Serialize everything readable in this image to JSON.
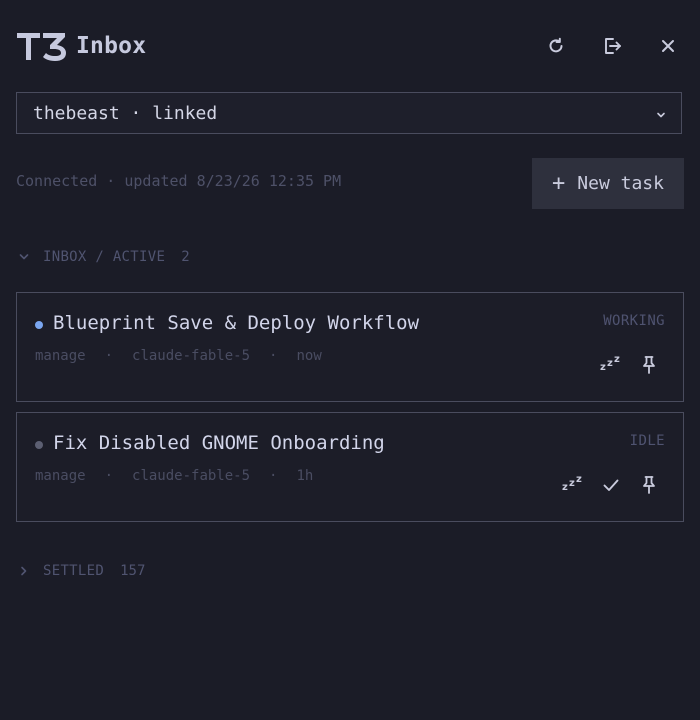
{
  "header": {
    "logo_text": "T3",
    "title": "Inbox",
    "icons": [
      "refresh-icon",
      "logout-icon",
      "close-icon"
    ]
  },
  "account": {
    "value": "thebeast · linked"
  },
  "status": {
    "text": "Connected · updated 8/23/26 12:35 PM"
  },
  "new_task": {
    "label": "New task"
  },
  "sections": {
    "active": {
      "title": "INBOX / ACTIVE",
      "count": "2",
      "expanded": true
    },
    "settled": {
      "title": "SETTLED",
      "count": "157",
      "expanded": false
    }
  },
  "tasks": [
    {
      "title": "Blueprint Save & Deploy Workflow",
      "project": "manage",
      "model": "claude-fable-5",
      "time": "now",
      "state": "WORKING",
      "dot_color": "#7aa6f0",
      "actions": [
        "snooze-icon",
        "pin-icon"
      ]
    },
    {
      "title": "Fix Disabled GNOME Onboarding",
      "project": "manage",
      "model": "claude-fable-5",
      "time": "1h",
      "state": "IDLE",
      "dot_color": "#5c5f72",
      "actions": [
        "snooze-icon",
        "check-icon",
        "pin-icon"
      ]
    }
  ],
  "meta_separator": "·",
  "colors": {
    "background": "#1b1c27",
    "border": "#4a4c5e",
    "button_bg": "#2e303d",
    "text_primary": "#d2d5ea",
    "text_muted": "#4e5168",
    "working_dot": "#7aa6f0",
    "idle_dot": "#5c5f72"
  }
}
